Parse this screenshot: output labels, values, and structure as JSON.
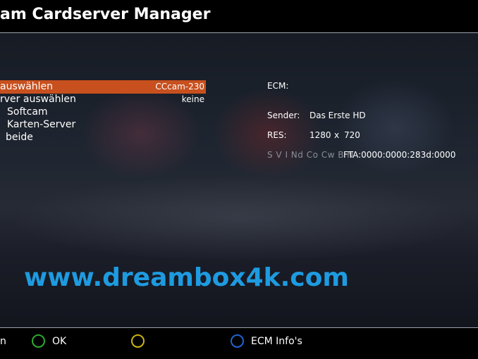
{
  "window": {
    "title": "am Cardserver Manager"
  },
  "menu": {
    "items": [
      {
        "label": "auswählen",
        "value": "CCcam-230",
        "selected": true
      },
      {
        "label": "rver auswählen",
        "value": "keine",
        "selected": false
      },
      {
        "label": "Softcam",
        "value": "",
        "selected": false
      },
      {
        "label": "Karten-Server",
        "value": "",
        "selected": false
      },
      {
        "label": "beide",
        "value": "",
        "selected": false
      }
    ]
  },
  "info": {
    "ecm_label": "ECM:",
    "ecm_value": "",
    "sender_label": "Sender:",
    "sender_value": "Das Erste HD",
    "res_label": "RES:",
    "res_width": "1280",
    "res_x": "x",
    "res_height": "720",
    "crypt_flags": "S V I Nd Co Cw B N",
    "fta_value": "FTA:0000:0000:283d:0000"
  },
  "watermark": {
    "text": "www.dreambox4k.com"
  },
  "footer": {
    "red_label": "n",
    "green_label": "OK",
    "yellow_label": "",
    "blue_label": "ECM Info's"
  },
  "colors": {
    "selection": "#c8501e",
    "green_key": "#2ea82e",
    "yellow_key": "#c8b414",
    "blue_key": "#1e64d2",
    "watermark": "#1e9be0"
  }
}
